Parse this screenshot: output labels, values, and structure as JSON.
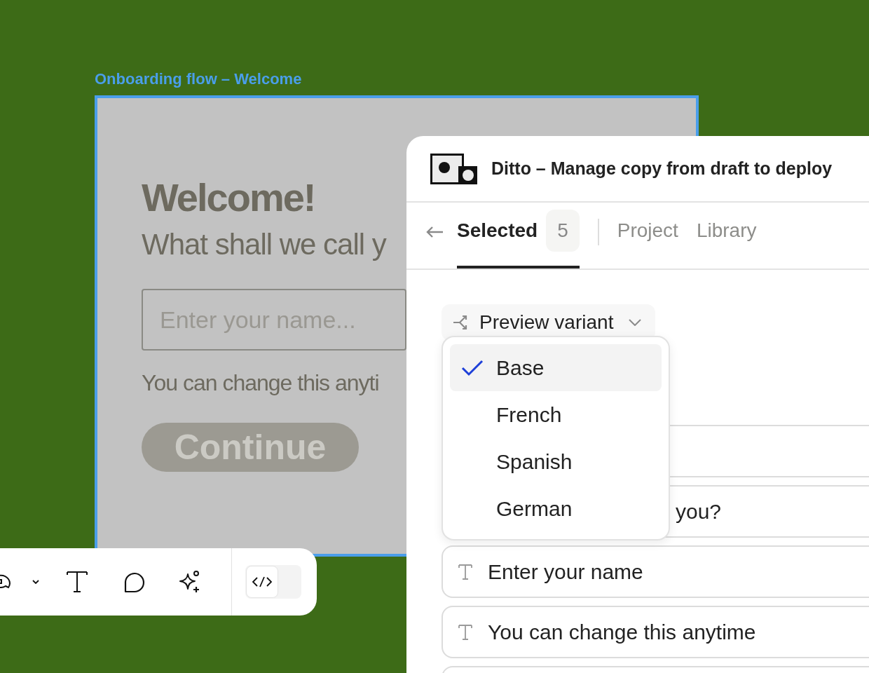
{
  "canvas": {
    "frame_label": "Onboarding flow – Welcome",
    "frame": {
      "heading": "Welcome!",
      "subheading": "What shall we call y",
      "name_field": {
        "placeholder": "Enter your name..."
      },
      "hint": "You can change this anyti",
      "button": "Continue"
    }
  },
  "toolbar": {
    "dev_mode": {
      "on": false
    }
  },
  "plugin": {
    "title": "Ditto – Manage copy from draft to deploy",
    "tabs": [
      {
        "label": "Selected",
        "count": "5",
        "selected": true
      },
      {
        "label": "Project",
        "selected": false
      },
      {
        "label": "Library",
        "selected": false
      }
    ],
    "variant_button": "Preview variant",
    "variant_menu": [
      {
        "label": "Base",
        "selected": true
      },
      {
        "label": "French",
        "selected": false
      },
      {
        "label": "Spanish",
        "selected": false
      },
      {
        "label": "German",
        "selected": false
      }
    ],
    "text_items": [
      {
        "kind": "covered"
      },
      {
        "kind": "covered",
        "text": "you?"
      },
      {
        "kind": "text",
        "text": "Enter your name"
      },
      {
        "kind": "text",
        "text": "You can change this anytime"
      },
      {
        "kind": "covered"
      }
    ]
  }
}
